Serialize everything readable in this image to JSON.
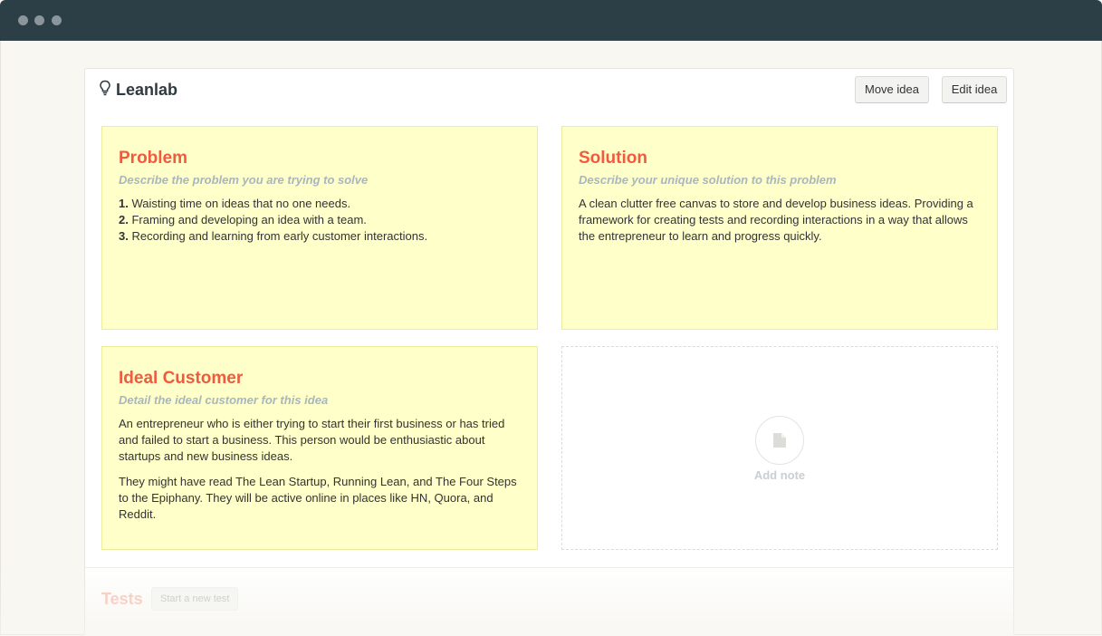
{
  "header": {
    "app_title": "Leanlab",
    "move_idea_label": "Move idea",
    "edit_idea_label": "Edit idea"
  },
  "notes": {
    "problem": {
      "title": "Problem",
      "subtitle": "Describe the problem you are trying to solve",
      "items": [
        {
          "num": "1.",
          "text": "Waisting time on ideas that no one needs."
        },
        {
          "num": "2.",
          "text": "Framing and developing an idea with a team."
        },
        {
          "num": "3.",
          "text": "Recording and learning from early customer interactions."
        }
      ]
    },
    "solution": {
      "title": "Solution",
      "subtitle": "Describe your unique solution to this problem",
      "paragraphs": [
        "A clean clutter free canvas to store and develop business ideas. Providing a framework for creating tests and recording interactions in a way that allows the entrepreneur to learn and progress quickly."
      ]
    },
    "ideal_customer": {
      "title": "Ideal Customer",
      "subtitle": "Detail the ideal customer for this idea",
      "paragraphs": [
        "An entrepreneur who is either trying to start their first business or has tried and failed to start a business. This person would be enthusiastic about startups and new business ideas.",
        "They might have read The Lean Startup, Running Lean, and The Four Steps to the Epiphany. They will be active online in places like HN, Quora, and Reddit."
      ]
    }
  },
  "add_note": {
    "label": "Add note",
    "icon": "document-icon"
  },
  "tests": {
    "title": "Tests",
    "start_label": "Start a new test"
  },
  "colors": {
    "titlebar": "#2c3e46",
    "note_bg": "#ffffc9",
    "note_title": "#f15a3f",
    "note_subtitle": "#a9b6bd"
  }
}
